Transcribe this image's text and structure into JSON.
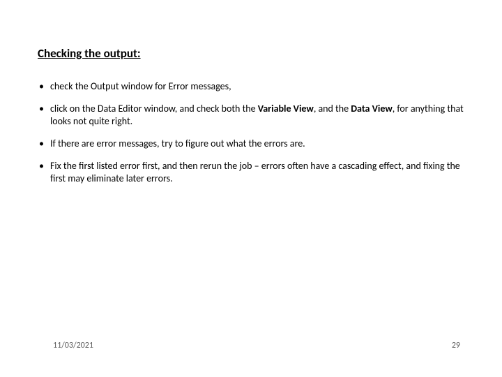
{
  "heading": "Checking the output:",
  "bullets": [
    {
      "pre": "check the Output window for Error messages,"
    },
    {
      "pre": "click on the Data Editor window, and check both the ",
      "b1": "Variable View",
      "mid": ", and the ",
      "b2": "Data View",
      "post": ", for anything that looks not quite right."
    },
    {
      "pre": "If there are error messages, try to figure out what the errors are."
    },
    {
      "pre": "Fix the first listed error first, and then rerun the job – errors often have a cascading effect, and fixing the first may eliminate later errors."
    }
  ],
  "footer": {
    "date": "11/03/2021",
    "page": "29"
  }
}
